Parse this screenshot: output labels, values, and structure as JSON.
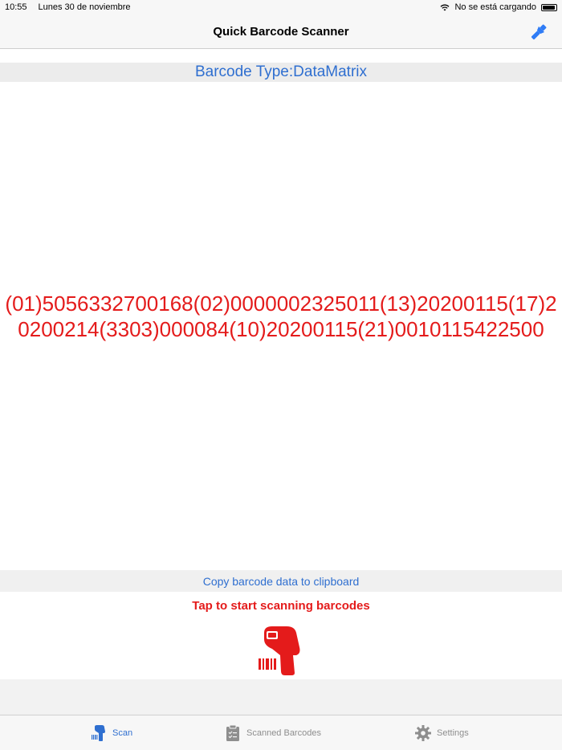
{
  "status_bar": {
    "time": "10:55",
    "date": "Lunes 30 de noviembre",
    "charging_status": "No se está cargando"
  },
  "nav": {
    "title": "Quick Barcode Scanner",
    "right_icon": "flashlight-icon"
  },
  "barcode": {
    "type_label": "Barcode Type:DataMatrix",
    "data": "(01)5056332700168(02)0000002325011(13)20200115(17)20200214(3303)000084(10)20200115(21)0010115422500"
  },
  "actions": {
    "copy_label": "Copy barcode data to clipboard",
    "scan_hint": "Tap to start scanning barcodes"
  },
  "tabs": [
    {
      "label": "Scan",
      "icon": "scanner-icon",
      "active": true
    },
    {
      "label": "Scanned Barcodes",
      "icon": "clipboard-icon",
      "active": false
    },
    {
      "label": "Settings",
      "icon": "gear-icon",
      "active": false
    }
  ],
  "colors": {
    "accent_blue": "#2f6fd0",
    "accent_red": "#e41b1b",
    "inactive_gray": "#8e8e8e"
  }
}
